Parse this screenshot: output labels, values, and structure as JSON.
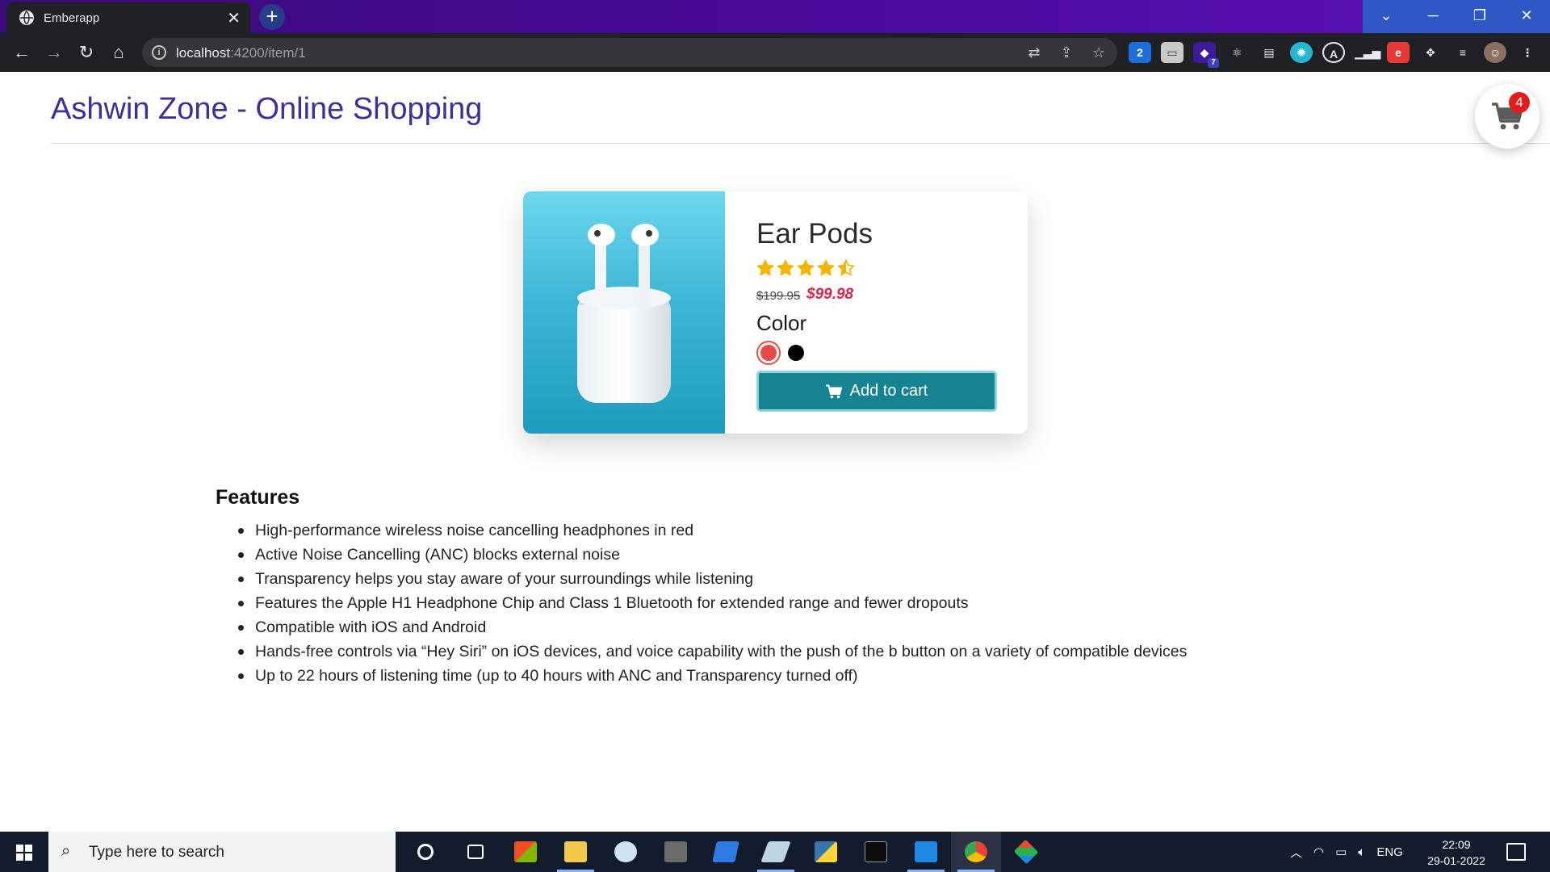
{
  "browser": {
    "tab_title": "Emberapp",
    "tab_close": "✕",
    "new_tab": "+",
    "url_host": "localhost",
    "url_path": ":4200/item/1",
    "extension_badge": "7",
    "extension_number": "2"
  },
  "site": {
    "title": "Ashwin Zone - Online Shopping",
    "cart_count": "4"
  },
  "product": {
    "name": "Ear Pods",
    "rating": 4.5,
    "rating_max": 5,
    "old_price": "$199.95",
    "new_price": "$99.98",
    "color_label": "Color",
    "colors": [
      "#e84a4a",
      "#000000"
    ],
    "selected_color": "#e84a4a",
    "add_to_cart_label": "Add to cart"
  },
  "features": {
    "title": "Features",
    "items": [
      "High-performance wireless noise cancelling headphones in red",
      "Active Noise Cancelling (ANC) blocks external noise",
      "Transparency helps you stay aware of your surroundings while listening",
      "Features the Apple H1 Headphone Chip and Class 1 Bluetooth for extended range and fewer dropouts",
      "Compatible with iOS and Android",
      "Hands-free controls via “Hey Siri” on iOS devices, and voice capability with the push of the b button on a variety of compatible devices",
      "Up to 22 hours of listening time (up to 40 hours with ANC and Transparency turned off)"
    ]
  },
  "taskbar": {
    "search_placeholder": "Type here to search",
    "language": "ENG",
    "time": "22:09",
    "date": "29-01-2022"
  },
  "colors": {
    "accent": "#3b3196",
    "button": "#168392",
    "price": "#d7264a",
    "star": "#f4b400",
    "badge": "#e21b1b"
  }
}
